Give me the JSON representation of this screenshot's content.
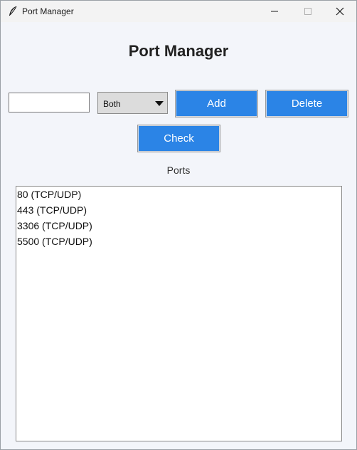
{
  "window": {
    "title": "Port Manager",
    "icon": "feather-icon"
  },
  "app": {
    "heading": "Port Manager"
  },
  "form": {
    "port_value": "",
    "protocol_selected": "Both",
    "add_label": "Add",
    "delete_label": "Delete",
    "check_label": "Check"
  },
  "ports": {
    "label": "Ports",
    "items": [
      "80 (TCP/UDP)",
      "443 (TCP/UDP)",
      "3306 (TCP/UDP)",
      "5500 (TCP/UDP)"
    ]
  },
  "colors": {
    "button_bg": "#2b84e6",
    "window_bg": "#f3f5fa"
  }
}
